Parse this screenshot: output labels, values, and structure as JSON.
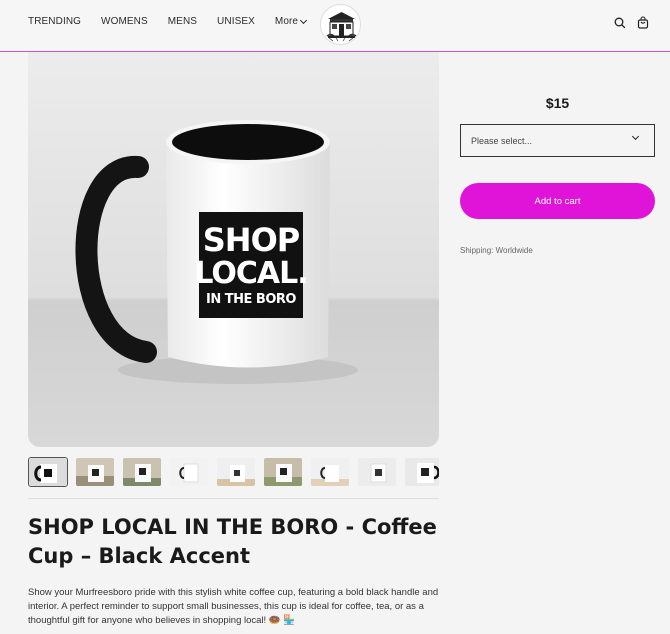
{
  "header": {
    "nav": [
      "TRENDING",
      "WOMENS",
      "MENS",
      "UNISEX"
    ],
    "more_label": "More"
  },
  "icons": {
    "search": "search-icon",
    "cart": "cart-icon",
    "more": "chevron-down-icon"
  },
  "product": {
    "mug_text": [
      "SHOP",
      "LOCAL.",
      "IN THE BORO"
    ],
    "title": "SHOP LOCAL IN THE BORO - Coffee Cup – Black Accent",
    "description": "Show your Murfreesboro pride with this stylish white coffee cup, featuring a bold black handle and interior. A perfect reminder to support small businesses, this cup is ideal for coffee, tea, or as a thoughtful gift for anyone who believes in shopping local! 🍩 🏪",
    "thumbnail_count": 9,
    "active_thumbnail": 1
  },
  "purchase": {
    "price": "$15",
    "select_placeholder": "Please select...",
    "add_to_cart": "Add to cart",
    "shipping": "Shipping: Worldwide"
  },
  "colors": {
    "accent": "#e014d9",
    "header_border": "#d24fd1"
  }
}
